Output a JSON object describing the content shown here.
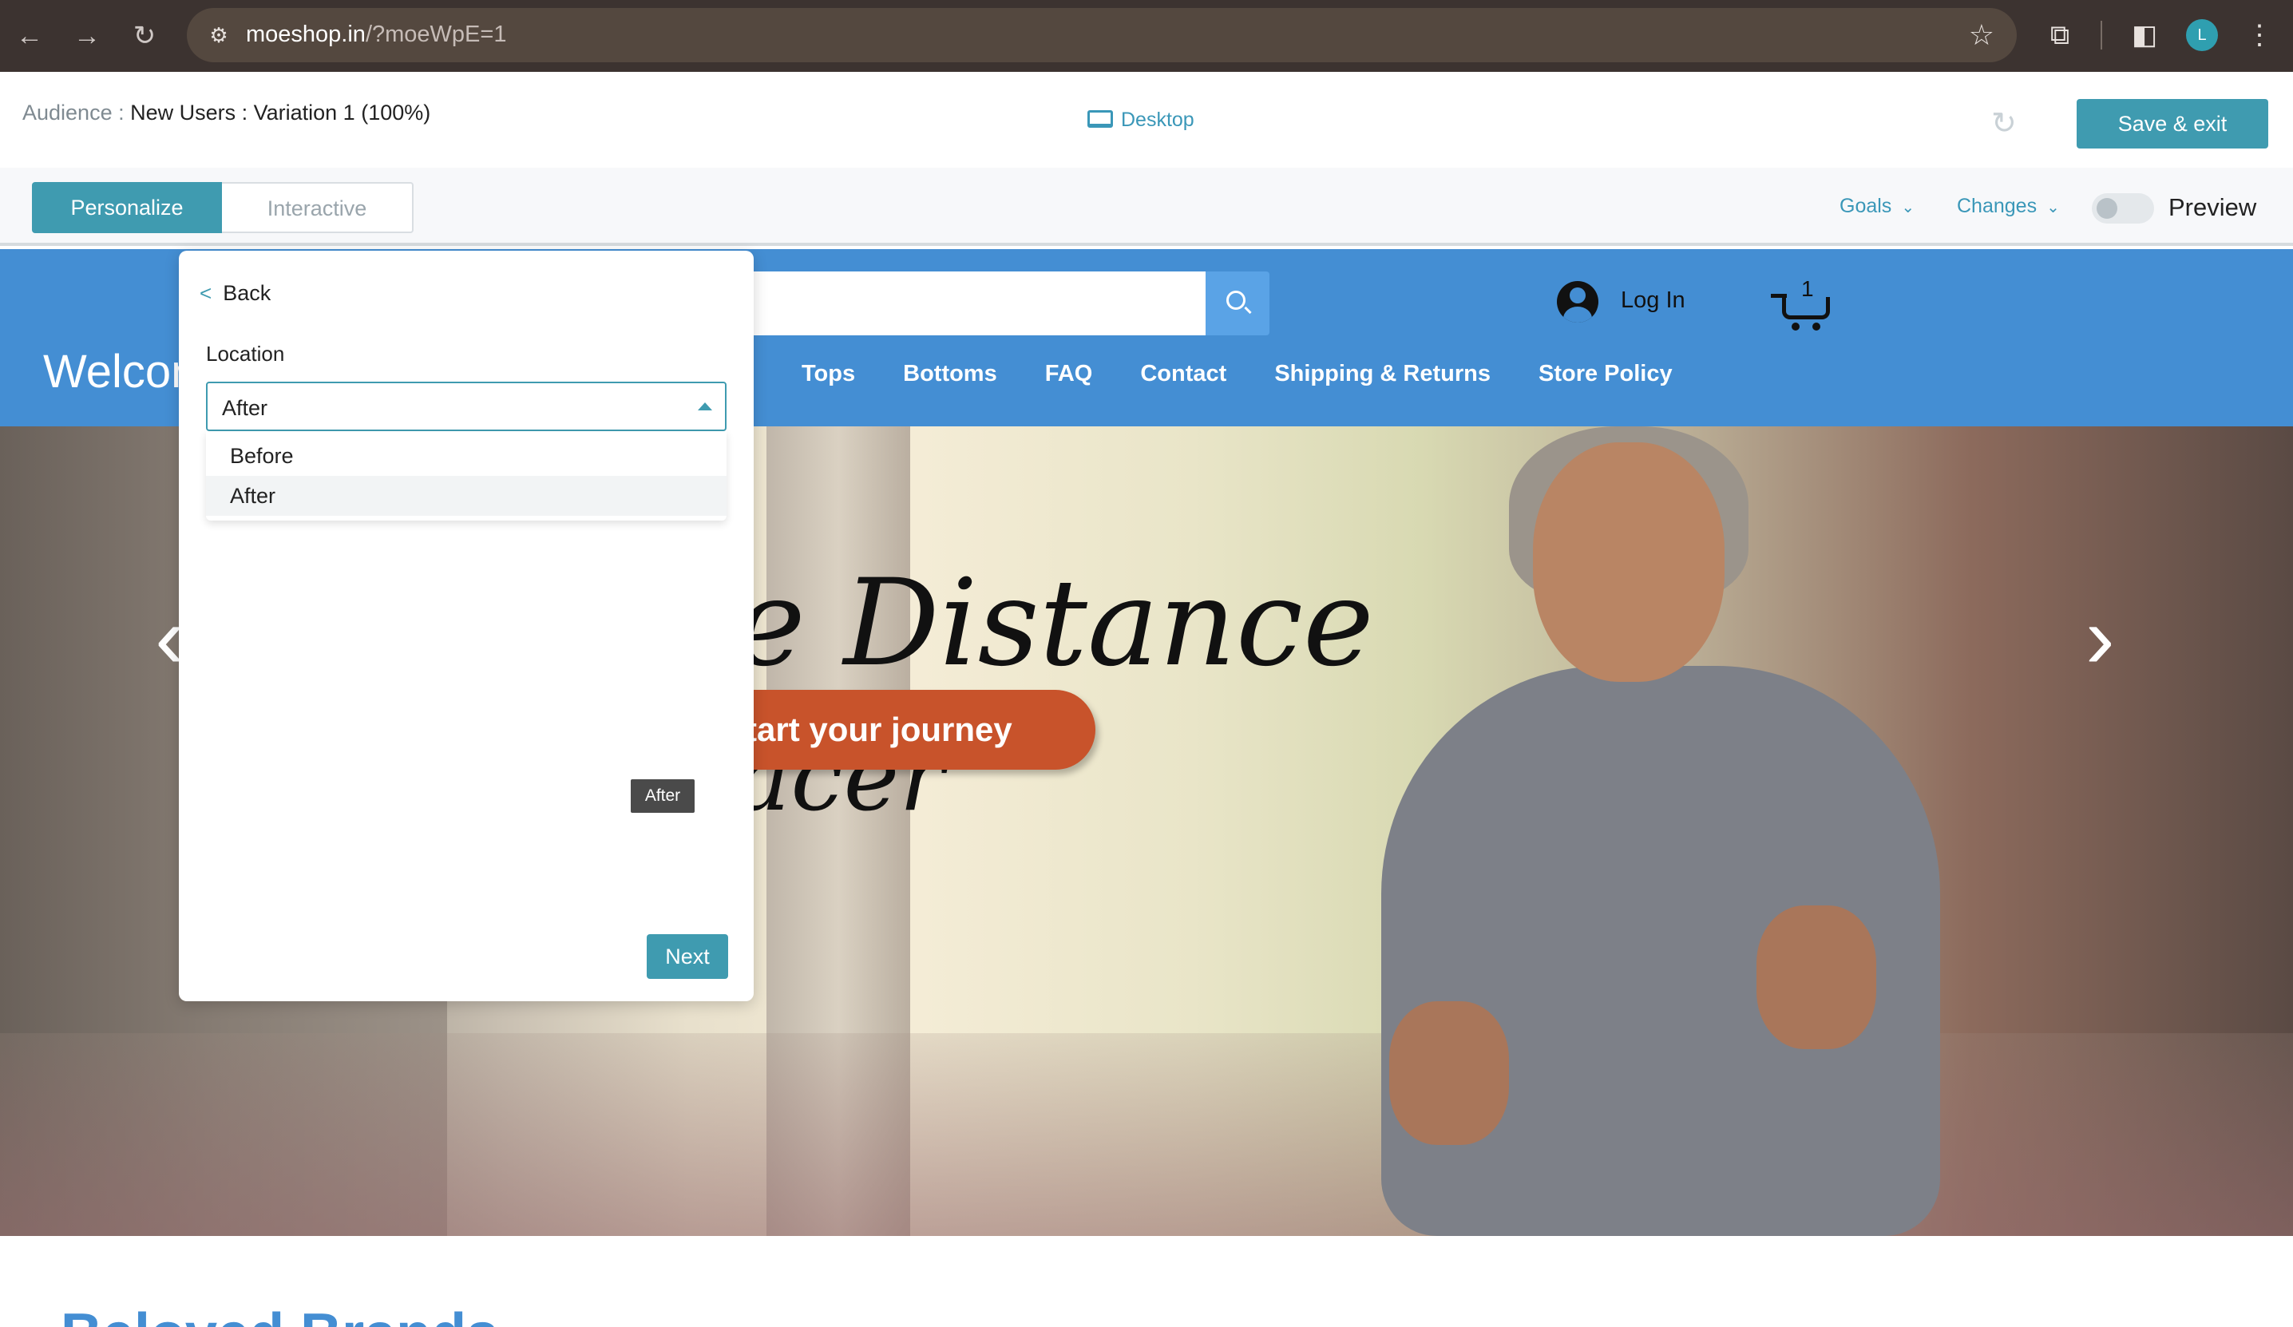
{
  "browser": {
    "url_host": "moeshop.in",
    "url_query": "/?moeWpE=1",
    "profile_initial": "L"
  },
  "editor": {
    "audience_label": "Audience : ",
    "audience_value": "New Users : Variation 1 (100%)",
    "device": "Desktop",
    "save_label": "Save & exit",
    "tabs": {
      "personalize": "Personalize",
      "interactive": "Interactive"
    },
    "goals_label": "Goals",
    "changes_label": "Changes",
    "preview_label": "Preview",
    "preview_on": false
  },
  "site": {
    "welcome": "Welcon",
    "login": "Log In",
    "cart_count": "1",
    "nav": [
      "Tops",
      "Bottoms",
      "FAQ",
      "Contact",
      "Shipping & Returns",
      "Store Policy"
    ],
    "hero_line1": "e Distance",
    "hero_line2": "acer",
    "cta": "tart your journey",
    "section_title": "Beloved Brands"
  },
  "panel": {
    "back_label": "Back",
    "location_label": "Location",
    "selected": "After",
    "options": [
      "Before",
      "After"
    ],
    "tooltip": "After",
    "next_label": "Next"
  },
  "colors": {
    "accent": "#3f9bb0",
    "site_header": "#448ed3",
    "cta": "#c8532b"
  }
}
